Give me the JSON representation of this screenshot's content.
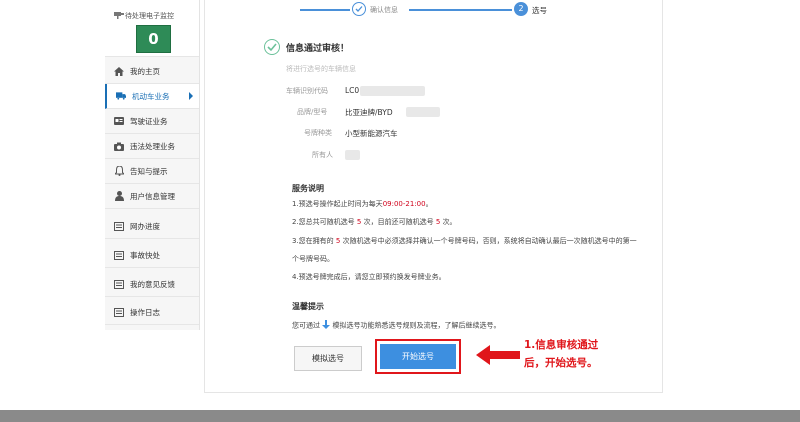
{
  "steps": {
    "step1_label": "确认信息",
    "step2_number": "2",
    "step2_label": "选号"
  },
  "sidebar": {
    "monitor_label": "待处理电子监控",
    "monitor_count": "0",
    "items": [
      {
        "label": "我的主页",
        "icon": "home-icon"
      },
      {
        "label": "机动车业务",
        "icon": "truck-icon",
        "active": true
      },
      {
        "label": "驾驶证业务",
        "icon": "card-icon"
      },
      {
        "label": "违法处理业务",
        "icon": "camera-icon"
      },
      {
        "label": "告知与提示",
        "icon": "bell-icon"
      },
      {
        "label": "用户信息管理",
        "icon": "user-icon"
      },
      {
        "label": "网办进度",
        "icon": "document-icon"
      },
      {
        "label": "事故快处",
        "icon": "document-icon"
      },
      {
        "label": "我的意见反馈",
        "icon": "document-icon"
      },
      {
        "label": "操作日志",
        "icon": "document-icon"
      }
    ]
  },
  "review": {
    "title": "信息通过审核！",
    "subtitle": "将进行选号的车辆信息",
    "fields": [
      {
        "label": "车辆识别代码",
        "value": "LC0"
      },
      {
        "label": "品牌/型号",
        "value": "比亚迪牌/BYD"
      },
      {
        "label": "号牌种类",
        "value": "小型新能源汽车"
      },
      {
        "label": "所有人",
        "value": ""
      }
    ]
  },
  "service": {
    "title": "服务说明",
    "line1_pre": "1.预选号操作起止时间为每天",
    "line1_time": "09:00-21:00",
    "line1_post": "。",
    "line2_a": "2.您总共可随机选号",
    "line2_n1": "5",
    "line2_b": "次，目前还可随机选号",
    "line2_n2": "5",
    "line2_c": "次。",
    "line3_a": "3.您在拥有的",
    "line3_n": "5",
    "line3_b": "次随机选号中必须选择并确认一个号牌号码，否则，系统将自动确认最后一次随机选号中的第一",
    "line3_cont": "个号牌号码。",
    "line4": "4.预选号牌完成后，请您立即预约换发号牌业务。"
  },
  "tips": {
    "title": "温馨提示",
    "text_pre": "您可通过",
    "text_post": "模拟选号功能熟悉选号规则及流程，了解后继续选号。"
  },
  "buttons": {
    "simulate": "模拟选号",
    "start": "开始选号"
  },
  "annotation": {
    "line1": "1.信息审核通过",
    "line2": "后，开始选号。"
  },
  "colors": {
    "accent": "#3d8fe0",
    "annotation_red": "#e0161b",
    "badge_green": "#2e8b57",
    "highlight_red": "#d0021b"
  }
}
